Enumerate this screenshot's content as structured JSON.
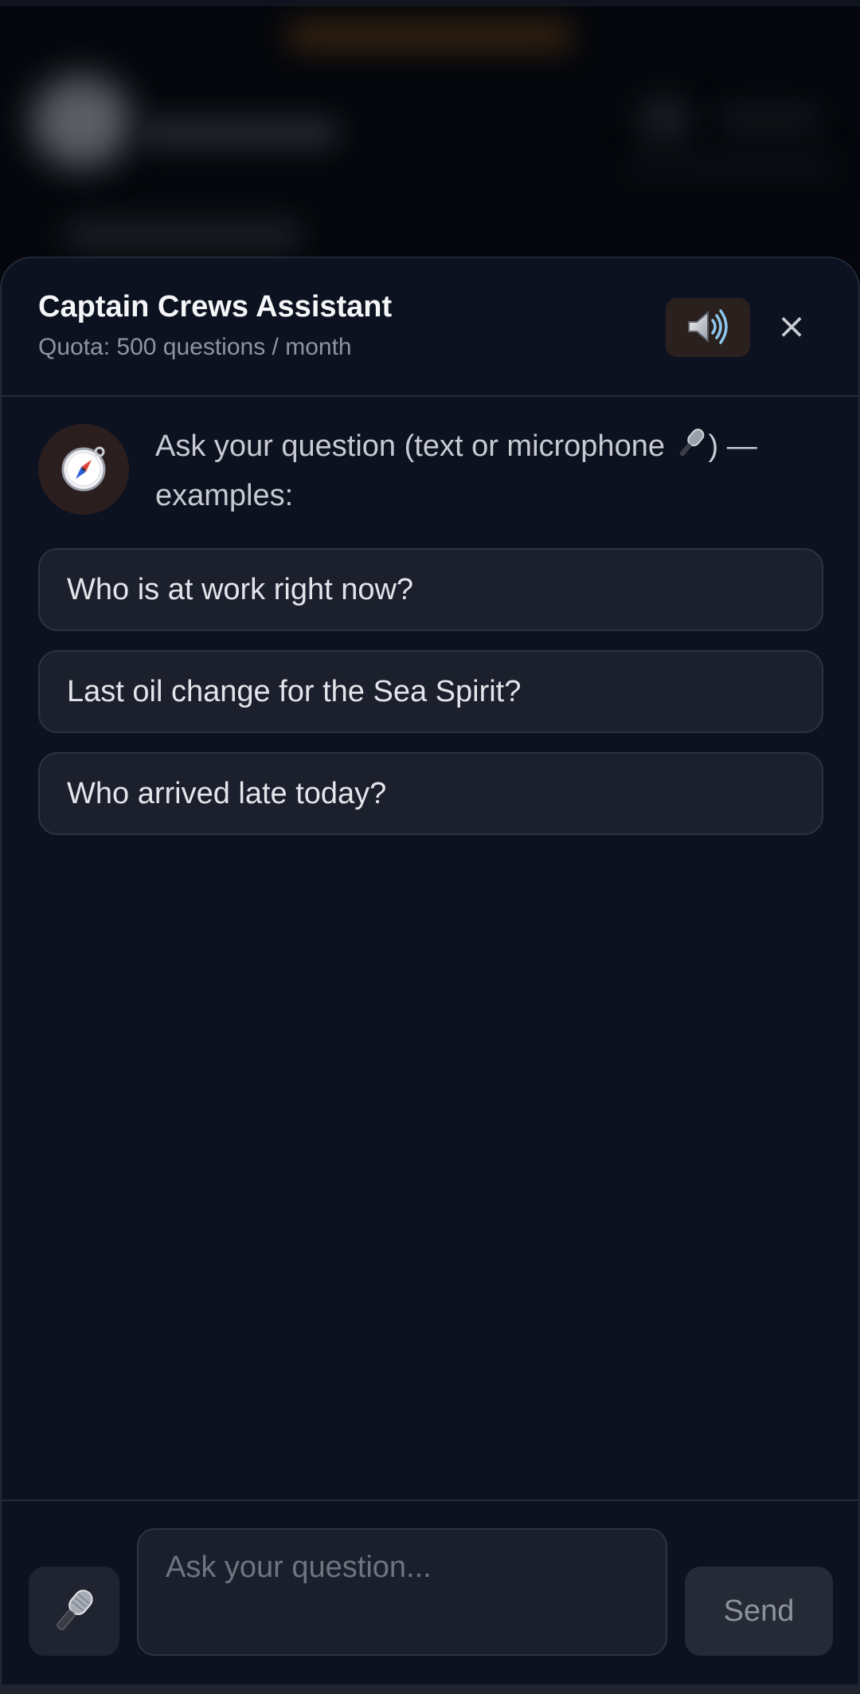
{
  "header": {
    "title": "Captain Crews Assistant",
    "quota": "Quota: 500 questions / month",
    "speaker_icon": "speaker-icon",
    "close_label": "×"
  },
  "intro": {
    "avatar_icon": "compass-icon",
    "text_before": "Ask your question (text or microphone ",
    "mic_icon": "microphone-icon",
    "text_after": ") — examples:"
  },
  "suggestions": [
    {
      "label": "Who is at work right now?"
    },
    {
      "label": "Last oil change for the Sea Spirit?"
    },
    {
      "label": "Who arrived late today?"
    }
  ],
  "composer": {
    "mic_icon": "microphone-icon",
    "placeholder": "Ask your question...",
    "send_label": "Send"
  },
  "colors": {
    "sheet_bg": "#0d1220",
    "suggestion_bg": "#1b202c",
    "speaker_btn_bg": "#2a201d",
    "avatar_bg": "#2b1e1e"
  }
}
